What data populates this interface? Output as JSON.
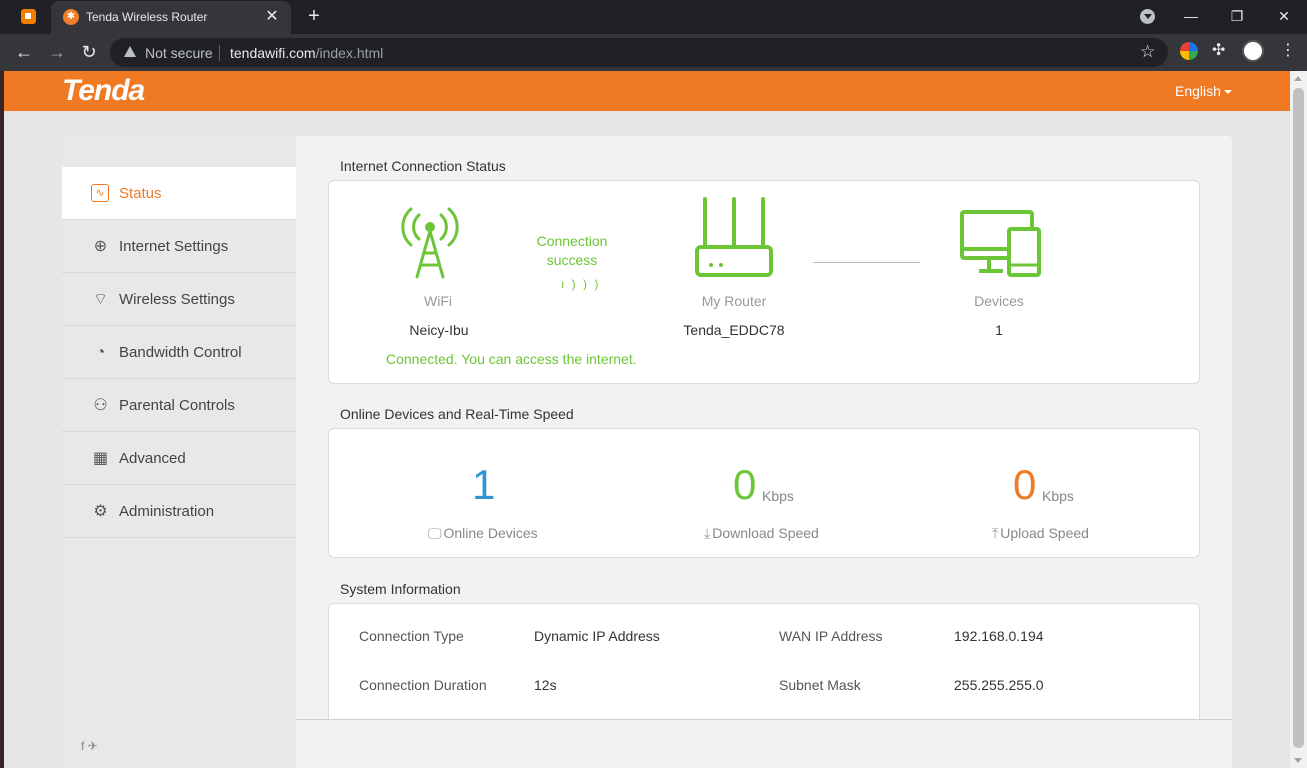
{
  "browser": {
    "tab_title": "Tenda Wireless Router",
    "tab_close": "✕",
    "new_tab": "+",
    "security_label": "Not secure",
    "url_host": "tendawifi.com",
    "url_path": "/index.html",
    "win_min": "—",
    "win_max": "❐",
    "win_close": "✕"
  },
  "header": {
    "logo": "Tenda",
    "language": "English"
  },
  "sidebar": {
    "items": [
      {
        "label": "Status",
        "icon": "status-icon",
        "glyph": "∿",
        "active": true
      },
      {
        "label": "Internet Settings",
        "icon": "globe-icon",
        "glyph": "⊕"
      },
      {
        "label": "Wireless Settings",
        "icon": "wifi-icon",
        "glyph": "⌔"
      },
      {
        "label": "Bandwidth Control",
        "icon": "gauge-icon",
        "glyph": "◔"
      },
      {
        "label": "Parental Controls",
        "icon": "family-icon",
        "glyph": "⚇"
      },
      {
        "label": "Advanced",
        "icon": "grid-icon",
        "glyph": "▦"
      },
      {
        "label": "Administration",
        "icon": "gear-icon",
        "glyph": "⚙"
      }
    ],
    "social": "f  ✈"
  },
  "internet_status": {
    "title": "Internet Connection Status",
    "wifi_label": "WiFi",
    "wifi_name": "Neicy-Ibu",
    "connection_line1": "Connection",
    "connection_line2": "success",
    "connection_waves": "ı ) ) )",
    "router_label": "My Router",
    "router_name": "Tenda_EDDC78",
    "devices_label": "Devices",
    "devices_count": "1",
    "message": "Connected. You can access the internet."
  },
  "realtime": {
    "title": "Online Devices and Real-Time Speed",
    "online_devices": "1",
    "online_devices_label": "Online Devices",
    "download_value": "0",
    "download_unit": "Kbps",
    "download_label": "Download Speed",
    "upload_value": "0",
    "upload_unit": "Kbps",
    "upload_label": "Upload Speed"
  },
  "system_info": {
    "title": "System Information",
    "connection_type_label": "Connection Type",
    "connection_type": "Dynamic IP Address",
    "wan_ip_label": "WAN IP Address",
    "wan_ip": "192.168.0.194",
    "connection_duration_label": "Connection Duration",
    "connection_duration": "12s",
    "subnet_mask_label": "Subnet Mask",
    "subnet_mask": "255.255.255.0"
  },
  "colors": {
    "brand_orange": "#f07a24",
    "success_green": "#6cc537",
    "devices_blue": "#2e96d4",
    "download_green": "#6cc537",
    "upload_orange": "#f07a24"
  }
}
